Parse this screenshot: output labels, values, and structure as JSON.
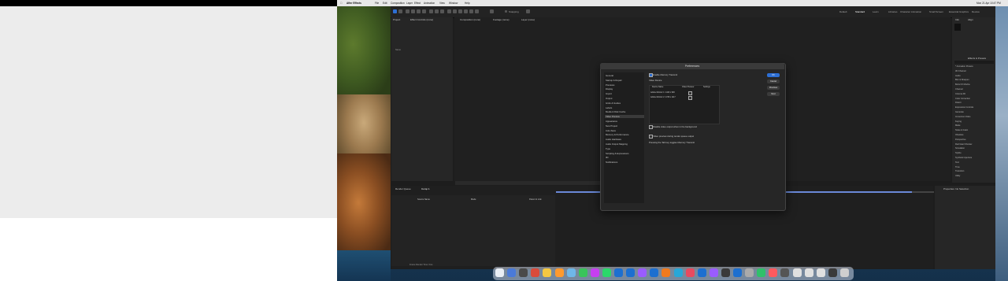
{
  "menubar": {
    "app": "After Effects",
    "items": [
      "File",
      "Edit",
      "Composition",
      "Layer",
      "Effect",
      "Animation",
      "View",
      "Window",
      "Help"
    ],
    "clock": "Mon 21 Apr 10:47 PM"
  },
  "toolbar": {
    "snapping": "Snapping",
    "workspaces": [
      "Default",
      "Standard",
      "Learn",
      "Libraries",
      "Character Animation",
      "Small Screen",
      "Essential Graphics",
      "Review"
    ]
  },
  "panels": {
    "project": "Project",
    "effect_controls": "Effect Controls (none)",
    "composition_tab": "Composition (none)",
    "footage_tab": "Footage (none)",
    "layer_tab": "Layer (none)",
    "name_col": "Name",
    "render_queue": "Render Queue",
    "comp_tab": "Comp 1",
    "source_name": "Source Name",
    "mode": "Mode",
    "parent_link": "Parent & Link",
    "properties": "Properties: No Selection",
    "info": "Info",
    "align": "Align",
    "effects_presets": "Effects & Presets",
    "frame_render_time": "Frame Render Time: 0ms"
  },
  "effects_list": [
    "* Animation Presets",
    "3D Channel",
    "Audio",
    "Blur & Sharpen",
    "Boris FX Mocha",
    "Channel",
    "Cinema 4D",
    "Color Correction",
    "Distort",
    "Expression Controls",
    "Generate",
    "Immersive Video",
    "Keying",
    "Matte",
    "Noise & Grain",
    "Obsolete",
    "Perspective",
    "Red Giant Shooter",
    "Simulation",
    "Stylize",
    "Synthetic Aperture",
    "Text",
    "Time",
    "Transition",
    "Utility"
  ],
  "preferences": {
    "title": "Preferences",
    "categories": [
      "General",
      "Startup & Repair",
      "Previews",
      "Display",
      "Import",
      "Output",
      "Grids & Guides",
      "Labels",
      "Media & Disk Cache",
      "Video Preview",
      "Appearance",
      "New Project",
      "Auto-Save",
      "Memory & Performance",
      "Audio Hardware",
      "Audio Output Mapping",
      "Type",
      "Scripting & Expressions",
      "3D",
      "Notifications"
    ],
    "selected_category": "Video Preview",
    "enable_mercury": "Enable Mercury Transmit",
    "video_device": "Video Device",
    "table_headers": [
      "Device Name",
      "Video Preview",
      "Settings"
    ],
    "devices": [
      "Adobe Monitor 1: 1440 x 900",
      "Adobe Monitor 2: 1728 x 1117"
    ],
    "disable_bg": "Disable video output when in the background",
    "video_preview_note": "Video preview during render queue output",
    "hint": "Pressing the Tab key toggles Mercury Transmit",
    "buttons": {
      "ok": "OK",
      "cancel": "Cancel",
      "previous": "Previous",
      "next": "Next"
    }
  },
  "colors": {
    "ae_bg": "#1d1d1d",
    "accent": "#2d6fd4",
    "timeline_blue": "#6a89d8"
  }
}
